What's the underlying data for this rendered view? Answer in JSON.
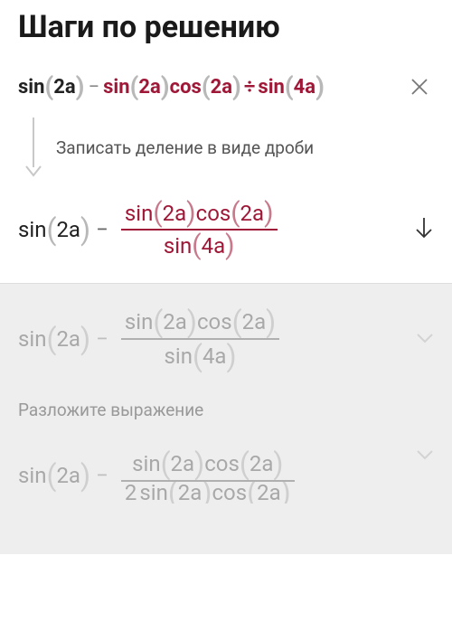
{
  "title": "Шаги по решению",
  "expression1": {
    "p1_fn": "sin",
    "p1_arg": "2a",
    "op1": "−",
    "p2_fn": "sin",
    "p2_arg": "2a",
    "p3_fn": "cos",
    "p3_arg": "2a",
    "op2": "÷",
    "p4_fn": "sin",
    "p4_arg": "4a"
  },
  "step1_label": "Записать деление в виде дроби",
  "expression2": {
    "left_fn": "sin",
    "left_arg": "2a",
    "op": "−",
    "num_fn1": "sin",
    "num_arg1": "2a",
    "num_fn2": "cos",
    "num_arg2": "2a",
    "den_fn": "sin",
    "den_arg": "4a"
  },
  "faded1": {
    "left_fn": "sin",
    "left_arg": "2a",
    "op": "−",
    "num_fn1": "sin",
    "num_arg1": "2a",
    "num_fn2": "cos",
    "num_arg2": "2a",
    "den_fn": "sin",
    "den_arg": "4a"
  },
  "faded_label": "Разложите выражение",
  "faded2": {
    "left_fn": "sin",
    "left_arg": "2a",
    "op": "−",
    "num_fn1": "sin",
    "num_arg1": "2a",
    "num_fn2": "cos",
    "num_arg2": "2a",
    "den_prefix": "2",
    "den_fn1": "sin",
    "den_arg1": "2a",
    "den_fn2": "cos",
    "den_arg2": "2a"
  }
}
